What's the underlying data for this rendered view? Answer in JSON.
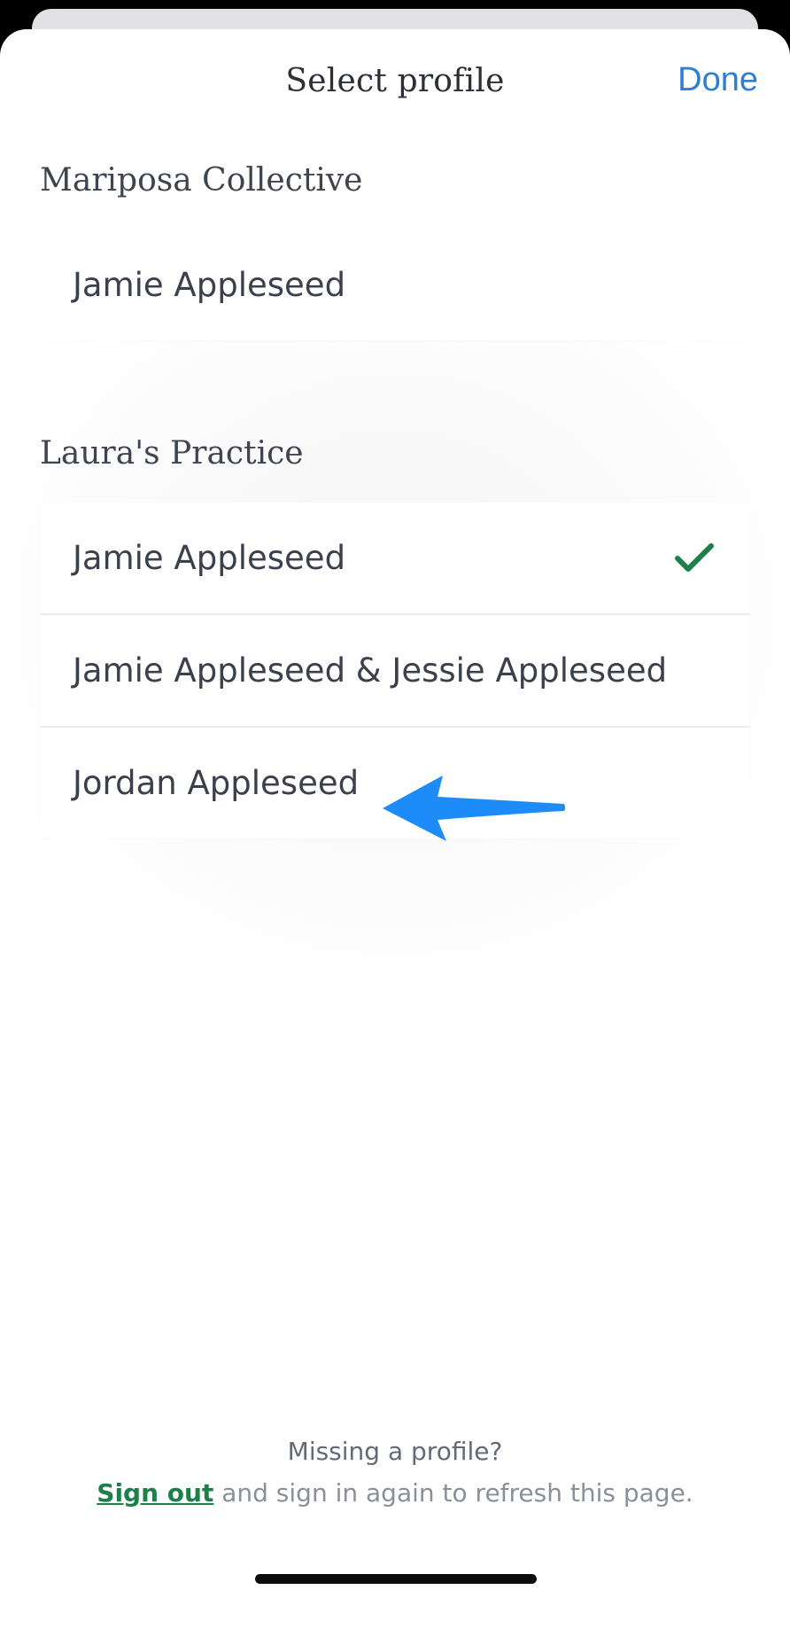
{
  "header": {
    "title": "Select profile",
    "done_label": "Done"
  },
  "groups": [
    {
      "title": "Mariposa Collective",
      "profiles": [
        {
          "name": "Jamie Appleseed",
          "selected": false
        }
      ]
    },
    {
      "title": "Laura's Practice",
      "profiles": [
        {
          "name": "Jamie Appleseed",
          "selected": true
        },
        {
          "name": "Jamie Appleseed & Jessie Appleseed",
          "selected": false
        },
        {
          "name": "Jordan Appleseed",
          "selected": false
        }
      ]
    }
  ],
  "footer": {
    "question": "Missing a profile?",
    "sign_out_label": "Sign out",
    "rest_text": " and sign in again to refresh this page."
  },
  "colors": {
    "accent_blue": "#2d7fd3",
    "check_green": "#1d7f4a",
    "annotation_arrow": "#1e8cf8"
  },
  "icons": {
    "selected": "checkmark-icon",
    "annotation": "arrow-left-icon"
  }
}
